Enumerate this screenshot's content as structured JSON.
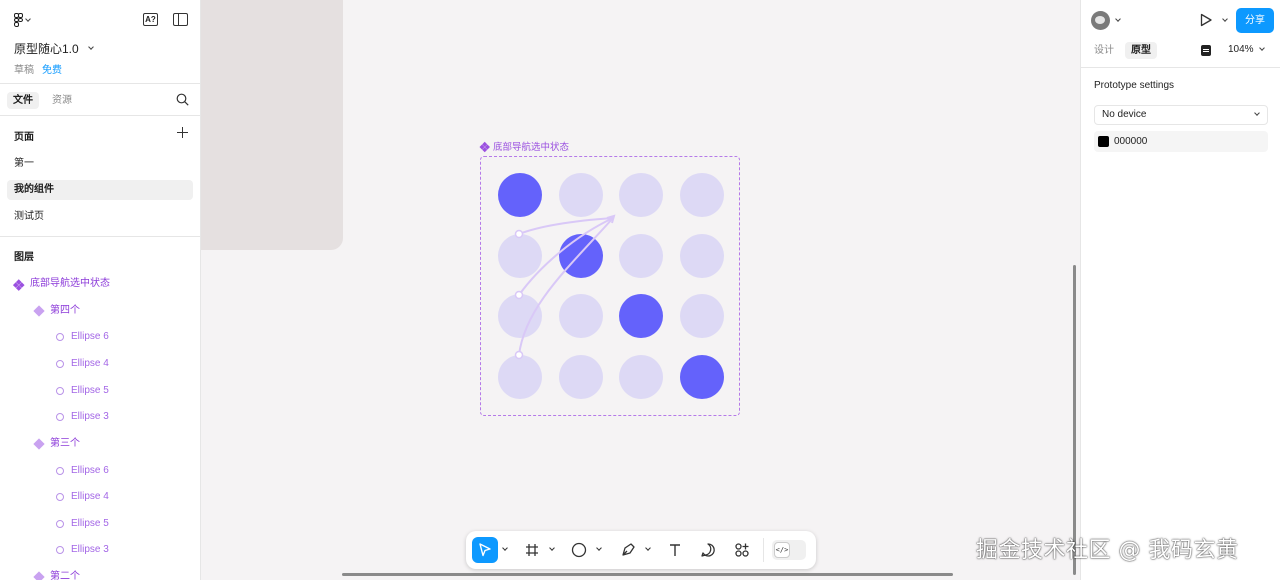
{
  "header": {
    "project_title": "原型随心1.0",
    "draft_label": "草稿",
    "plan_label": "免费",
    "ai_badge": "A?"
  },
  "tabs": {
    "file": "文件",
    "assets": "资源"
  },
  "pages": {
    "title": "页面",
    "items": [
      "第一",
      "我的组件",
      "测试页"
    ],
    "selected": "我的组件"
  },
  "layers": {
    "title": "图层",
    "root": "底部导航选中状态",
    "groups": [
      {
        "name": "第四个",
        "children": [
          "Ellipse 6",
          "Ellipse 4",
          "Ellipse 5",
          "Ellipse 3"
        ]
      },
      {
        "name": "第三个",
        "children": [
          "Ellipse 6",
          "Ellipse 4",
          "Ellipse 5",
          "Ellipse 3"
        ]
      },
      {
        "name": "第二个"
      }
    ]
  },
  "canvas": {
    "component_label": "底部导航选中状态"
  },
  "right_panel": {
    "share_label": "分享",
    "tab_design": "设计",
    "tab_prototype": "原型",
    "zoom": "104%",
    "settings_title": "Prototype settings",
    "device": "No device",
    "background_color": "000000"
  },
  "toolbar": {
    "dev_mode": "</>"
  },
  "watermark": "掘金技术社区 @ 我码玄黄",
  "colors": {
    "accent": "#0d99ff",
    "component_purple": "#9b51e0",
    "dot_active": "#6462fb",
    "dot_inactive": "#ddd9f5"
  }
}
